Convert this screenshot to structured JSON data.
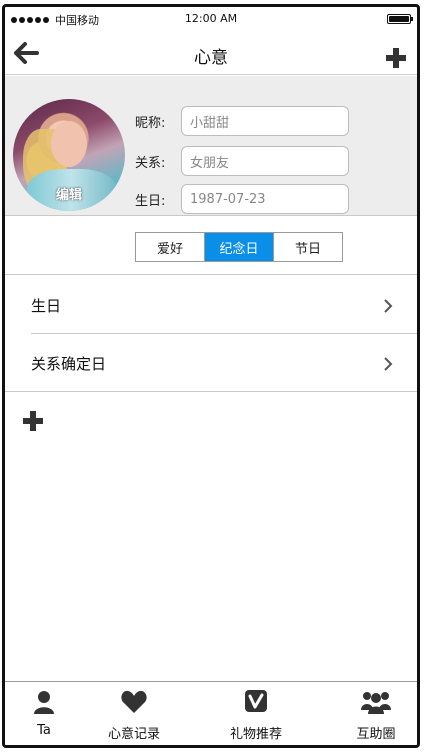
{
  "status_bar": {
    "carrier": "中国移动",
    "time": "12:00 AM",
    "signal_dots": 5
  },
  "navbar": {
    "title": "心意",
    "back_icon": "back-arrow-icon",
    "add_icon": "plus-icon"
  },
  "profile": {
    "avatar_edit_label": "编辑",
    "nickname": {
      "label": "昵称:",
      "value": "小甜甜"
    },
    "relation": {
      "label": "关系:",
      "value": "女朋友"
    },
    "birthday": {
      "label": "生日:",
      "value": "1987-07-23"
    }
  },
  "segments": [
    {
      "label": "爱好",
      "active": false
    },
    {
      "label": "纪念日",
      "active": true
    },
    {
      "label": "节日",
      "active": false
    }
  ],
  "list": [
    {
      "label": "生日"
    },
    {
      "label": "关系确定日"
    }
  ],
  "add_icon": "plus-icon",
  "tabbar": [
    {
      "label": "Ta",
      "icon": "person-icon"
    },
    {
      "label": "心意记录",
      "icon": "heart-icon"
    },
    {
      "label": "礼物推荐",
      "icon": "gift-v-icon"
    },
    {
      "label": "互助圈",
      "icon": "group-icon"
    }
  ],
  "colors": {
    "accent": "#0a8fe8",
    "header_bg": "#ededed",
    "border": "#c9c9c9"
  }
}
